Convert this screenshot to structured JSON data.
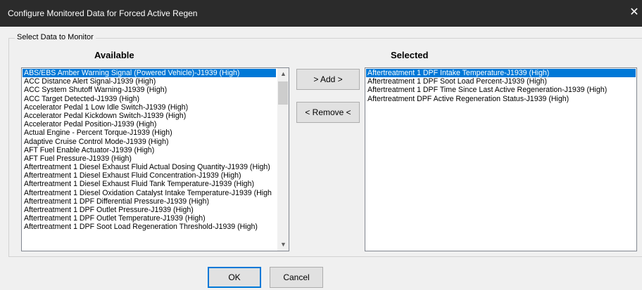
{
  "window": {
    "title": "Configure Monitored Data for Forced Active Regen",
    "close_glyph": "✕"
  },
  "group": {
    "label": "Select Data to Monitor"
  },
  "available": {
    "header": "Available",
    "items": [
      "ABS/EBS Amber Warning Signal (Powered Vehicle)-J1939 (High)",
      "ACC Distance Alert Signal-J1939 (High)",
      "ACC System Shutoff Warning-J1939 (High)",
      "ACC Target Detected-J1939 (High)",
      "Accelerator Pedal 1 Low Idle Switch-J1939 (High)",
      "Accelerator Pedal Kickdown Switch-J1939 (High)",
      "Accelerator Pedal Position-J1939 (High)",
      "Actual Engine - Percent Torque-J1939 (High)",
      "Adaptive Cruise Control Mode-J1939 (High)",
      "AFT Fuel Enable Actuator-J1939 (High)",
      "AFT Fuel Pressure-J1939 (High)",
      "Aftertreatment 1 Diesel Exhaust Fluid Actual Dosing Quantity-J1939 (High)",
      "Aftertreatment 1 Diesel Exhaust Fluid Concentration-J1939 (High)",
      "Aftertreatment 1 Diesel Exhaust Fluid Tank Temperature-J1939 (High)",
      "Aftertreatment 1 Diesel Oxidation Catalyst Intake Temperature-J1939 (High",
      "Aftertreatment 1 DPF Differential Pressure-J1939 (High)",
      "Aftertreatment 1 DPF Outlet Pressure-J1939 (High)",
      "Aftertreatment 1 DPF Outlet Temperature-J1939 (High)",
      "Aftertreatment 1 DPF Soot Load Regeneration Threshold-J1939 (High)"
    ],
    "scroll_up_glyph": "▲",
    "scroll_down_glyph": "▼"
  },
  "selected": {
    "header": "Selected",
    "items": [
      "Aftertreatment 1 DPF Intake Temperature-J1939 (High)",
      "Aftertreatment 1 DPF Soot Load Percent-J1939 (High)",
      "Aftertreatment 1 DPF Time Since Last Active Regeneration-J1939 (High)",
      "Aftertreatment DPF Active Regeneration Status-J1939 (High)"
    ]
  },
  "buttons": {
    "add": "> Add >",
    "remove": "< Remove <",
    "ok": "OK",
    "cancel": "Cancel"
  },
  "colors": {
    "titlebar": "#2b2b2b",
    "selection": "#0078d7",
    "dialog_bg": "#f0f0f0"
  }
}
